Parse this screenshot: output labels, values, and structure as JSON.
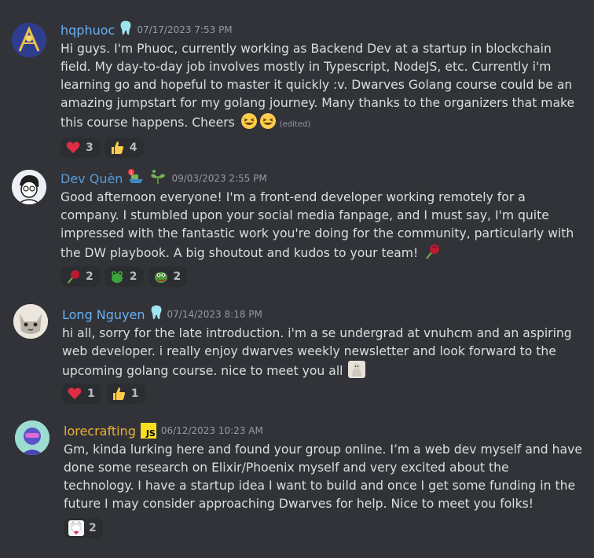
{
  "messages": [
    {
      "username": "hqphuoc",
      "username_color": "#6ab0f3",
      "timestamp": "07/17/2023 7:53 PM",
      "text": "Hi guys. I'm Phuoc, currently working as Backend Dev at a startup in blockchain field. My day-to-day job involves mostly in Typescript, NodeJS, etc. Currently i'm learning go and hopeful to master it quickly :v. Dwarves Golang course could be an amazing jumpstart for my golang journey. Many thanks to the organizers that make this course happens. Cheers",
      "edited": "(edited)",
      "reactions": [
        {
          "icon": "heart-icon",
          "count": "3"
        },
        {
          "icon": "thumbs-up-icon",
          "count": "4"
        }
      ]
    },
    {
      "username": "Dev Quèn",
      "username_color": "#5b9bd5",
      "timestamp": "09/03/2023 2:55 PM",
      "text": "Good afternoon everyone! I'm a front-end developer working remotely for a company. I stumbled upon your social media fanpage, and I must say, I'm quite impressed with the fantastic work you're doing for the community, particularly with the DW playbook. A big shoutout and kudos to your team!",
      "reactions": [
        {
          "icon": "rose-icon",
          "count": "2"
        },
        {
          "icon": "frog-icon",
          "count": "2"
        },
        {
          "icon": "pepe-icon",
          "count": "2"
        }
      ]
    },
    {
      "username": "Long Nguyen",
      "username_color": "#6ab0f3",
      "timestamp": "07/14/2023 8:18 PM",
      "text": "hi all, sorry for the late introduction. i'm a se undergrad at vnuhcm and an aspiring web developer. i really enjoy dwarves weekly newsletter and look forward to the upcoming golang course. nice to meet you all",
      "reactions": [
        {
          "icon": "heart-icon",
          "count": "1"
        },
        {
          "icon": "thumbs-up-icon",
          "count": "1"
        }
      ]
    },
    {
      "username": "lorecrafting",
      "username_color": "#f0b132",
      "badge": "JS",
      "timestamp": "06/12/2023 10:23 AM",
      "text": "Gm, kinda lurking here and found your group online. I’m a web dev myself and have done some research on Elixir/Phoenix myself and very excited about the technology. I have a startup idea I want to build and once I get some funding in the future I may consider approaching Dwarves for help. Nice to meet you folks!",
      "reactions": [
        {
          "icon": "cat-icon",
          "count": "2"
        }
      ]
    }
  ]
}
